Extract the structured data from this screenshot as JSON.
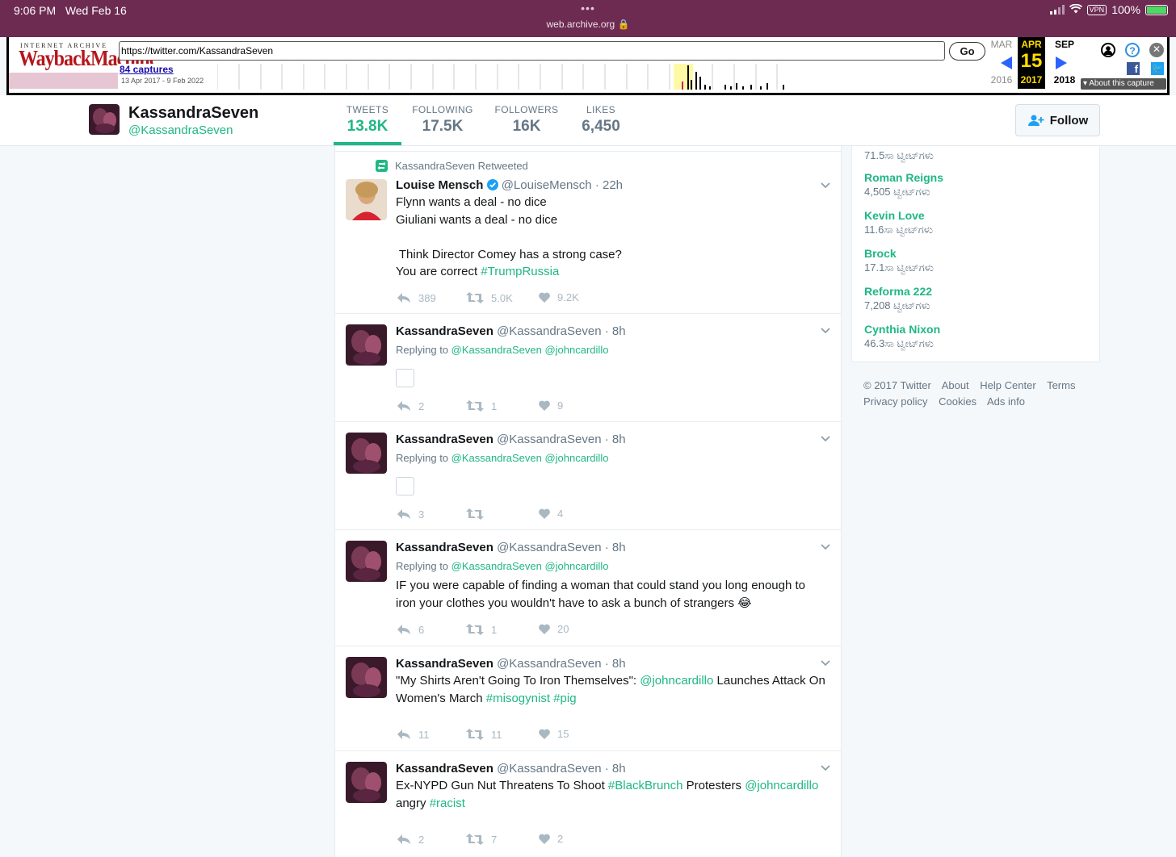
{
  "status_bar": {
    "time": "9:06 PM",
    "date": "Wed Feb 16",
    "url": "web.archive.org",
    "battery": "100%",
    "vpn": "VPN"
  },
  "wayback": {
    "logo_top": "INTERNET ARCHIVE",
    "logo_main": "WaybackMachine",
    "url_value": "https://twitter.com/KassandraSeven",
    "go_label": "Go",
    "captures_link": "84 captures",
    "captures_range": "13 Apr 2017 - 9 Feb 2022",
    "prev_month": "MAR",
    "prev_year": "2016",
    "current_month": "APR",
    "current_day": "15",
    "current_year": "2017",
    "next_month": "SEP",
    "next_year": "2018",
    "about_label": "About this capture"
  },
  "profile": {
    "name": "KassandraSeven",
    "handle": "@KassandraSeven",
    "stats": [
      {
        "label": "TWEETS",
        "value": "13.8K"
      },
      {
        "label": "FOLLOWING",
        "value": "17.5K"
      },
      {
        "label": "FOLLOWERS",
        "value": "16K"
      },
      {
        "label": "LIKES",
        "value": "6,450"
      }
    ],
    "follow_label": "Follow"
  },
  "timeline": {
    "retweet_note": "KassandraSeven Retweeted",
    "tweets": [
      {
        "name": "Louise Mensch",
        "handle": "@LouiseMensch",
        "time": "· 22h",
        "lines": [
          "Flynn wants a deal - no dice",
          "Giuliani wants a deal - no dice",
          "",
          " Think Director Comey has a strong case?"
        ],
        "last_line_text": "You are correct ",
        "last_line_tag": "#TrumpRussia",
        "replies": "389",
        "retweets": "5.0K",
        "likes": "9.2K"
      },
      {
        "name": "KassandraSeven",
        "handle": "@KassandraSeven",
        "time": "· 8h",
        "replying_prefix": "Replying to ",
        "replying_to": "@KassandraSeven @johncardillo",
        "replies": "2",
        "retweets": "1",
        "likes": "9"
      },
      {
        "name": "KassandraSeven",
        "handle": "@KassandraSeven",
        "time": "· 8h",
        "replying_prefix": "Replying to ",
        "replying_to": "@KassandraSeven @johncardillo",
        "replies": "3",
        "retweets": "",
        "likes": "4"
      },
      {
        "name": "KassandraSeven",
        "handle": "@KassandraSeven",
        "time": "· 8h",
        "replying_prefix": "Replying to ",
        "replying_to": "@KassandraSeven @johncardillo",
        "line1": "IF you were capable of finding a woman that could stand you long enough to",
        "line2": "iron your clothes you wouldn't have to ask a bunch of strangers ",
        "emoji": "😂",
        "replies": "6",
        "retweets": "1",
        "likes": "20"
      },
      {
        "name": "KassandraSeven",
        "handle": "@KassandraSeven",
        "time": "· 8h",
        "t1": "\"My Shirts Aren't Going To Iron Themselves\": ",
        "t2": "@johncardillo",
        "t3": " Launches Attack On",
        "t4": "Women's March ",
        "t5": "#misogynist",
        "t6": " ",
        "t7": "#pig",
        "replies": "11",
        "retweets": "11",
        "likes": "15"
      },
      {
        "name": "KassandraSeven",
        "handle": "@KassandraSeven",
        "time": "· 8h",
        "t1": "Ex-NYPD Gun Nut Threatens To Shoot ",
        "t2": "#BlackBrunch",
        "t3": " Protesters ",
        "t4": "@johncardillo",
        "t5": "angry ",
        "t6": "#racist",
        "replies": "2",
        "retweets": "7",
        "likes": "2"
      }
    ]
  },
  "trends": [
    {
      "name": "",
      "count": "71.5ಸಾ ಟ್ವೀಟ್‌ಗಳು"
    },
    {
      "name": "Roman Reigns",
      "count": "4,505 ಟ್ವೀಟ್‌ಗಳು"
    },
    {
      "name": "Kevin Love",
      "count": "11.6ಸಾ ಟ್ವೀಟ್‌ಗಳು"
    },
    {
      "name": "Brock",
      "count": "17.1ಸಾ ಟ್ವೀಟ್‌ಗಳು"
    },
    {
      "name": "Reforma 222",
      "count": "7,208 ಟ್ವೀಟ್‌ಗಳು"
    },
    {
      "name": "Cynthia Nixon",
      "count": "46.3ಸಾ ಟ್ವೀಟ್‌ಗಳು"
    }
  ],
  "footer": {
    "copyright": "© 2017 Twitter",
    "about": "About",
    "help": "Help Center",
    "terms": "Terms",
    "privacy": "Privacy policy",
    "cookies": "Cookies",
    "ads": "Ads info"
  },
  "colors": {
    "accent": "#1fb785",
    "status_bar": "#6d2b52",
    "wayback_red": "#b5161b",
    "wayback_blue": "#2b62ff"
  },
  "icons": [
    "reply-icon",
    "retweet-icon",
    "heart-icon",
    "chevron-down-icon",
    "verified-icon",
    "follow-user-icon",
    "help-icon",
    "close-icon",
    "facebook-icon",
    "twitter-icon",
    "user-icon"
  ]
}
